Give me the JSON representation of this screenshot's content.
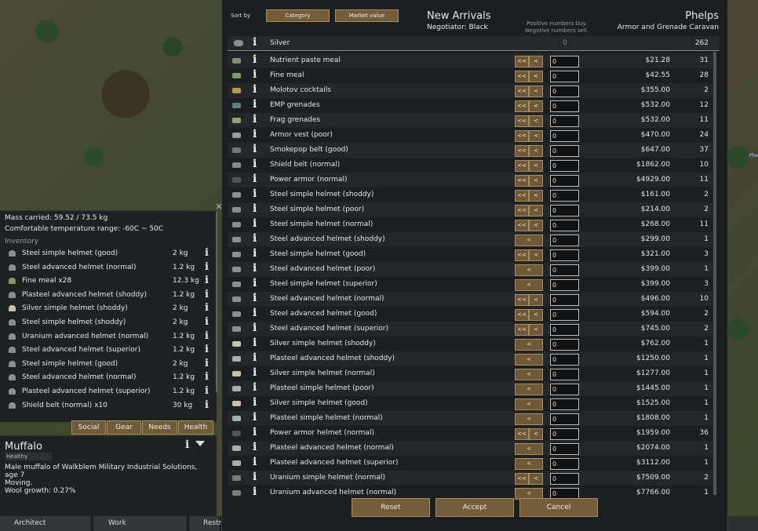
{
  "map": {
    "pawn_label": "Phe"
  },
  "left_panel": {
    "mass": "Mass carried: 59.52 / 73.5 kg",
    "temp": "Comfortable temperature range: -60C ~ 50C",
    "inventory_label": "Inventory",
    "items": [
      {
        "name": "Steel simple helmet (good)",
        "weight": "2 kg"
      },
      {
        "name": "Steel advanced helmet (normal)",
        "weight": "1.2 kg"
      },
      {
        "name": "Fine meal x28",
        "weight": "12.3 kg"
      },
      {
        "name": "Plasteel advanced helmet (shoddy)",
        "weight": "1.2 kg"
      },
      {
        "name": "Silver simple helmet (shoddy)",
        "weight": "2 kg"
      },
      {
        "name": "Steel simple helmet (shoddy)",
        "weight": "2 kg"
      },
      {
        "name": "Uranium advanced helmet (normal)",
        "weight": "1.2 kg"
      },
      {
        "name": "Steel advanced helmet (superior)",
        "weight": "1.2 kg"
      },
      {
        "name": "Steel simple helmet (good)",
        "weight": "2 kg"
      },
      {
        "name": "Steel advanced helmet (normal)",
        "weight": "1.2 kg"
      },
      {
        "name": "Plasteel advanced helmet (superior)",
        "weight": "1.2 kg"
      },
      {
        "name": "Shield belt (normal) x10",
        "weight": "30 kg"
      }
    ],
    "info_glyph": "i",
    "close_glyph": "×"
  },
  "tabs": {
    "social": "Social",
    "gear": "Gear",
    "needs": "Needs",
    "health": "Health"
  },
  "inspect": {
    "name": "Muffalo",
    "health": "Healthy",
    "line1": "Male muffalo of Walkblem Military Industrial Solutions, age 7",
    "line2": "Moving.",
    "line3": "Wool growth: 0.27%"
  },
  "bottom_bar": {
    "architect": "Architect",
    "work": "Work",
    "restrict": "Restr"
  },
  "trade": {
    "sort_by": "Sort by",
    "sort_category": "Category",
    "sort_market": "Market value",
    "title": "New Arrivals",
    "negotiator": "Negotiator: Black",
    "hint_line1": "Positive numbers buy.",
    "hint_line2": "Negative numbers sell.",
    "trader_name": "Phelps",
    "trader_type": "Armor and Grenade Caravan",
    "silver": {
      "name": "Silver",
      "amount": "0",
      "qty": "262"
    },
    "rows": [
      {
        "name": "Nutrient paste meal",
        "buttons": "both",
        "value": "0",
        "price": "$21.28",
        "qty": "31",
        "icon": "#8a8f6a"
      },
      {
        "name": "Fine meal",
        "buttons": "both",
        "value": "0",
        "price": "$42.55",
        "qty": "28",
        "icon": "#7e9a6c"
      },
      {
        "name": "Molotov cocktails",
        "buttons": "both",
        "value": "0",
        "price": "$355.00",
        "qty": "2",
        "icon": "#b59a52"
      },
      {
        "name": "EMP grenades",
        "buttons": "both",
        "value": "0",
        "price": "$532.00",
        "qty": "12",
        "icon": "#5d7f86"
      },
      {
        "name": "Frag grenades",
        "buttons": "both",
        "value": "0",
        "price": "$532.00",
        "qty": "11",
        "icon": "#98a06b"
      },
      {
        "name": "Armor vest (poor)",
        "buttons": "both",
        "value": "0",
        "price": "$470.00",
        "qty": "24",
        "icon": "#9a9a9a"
      },
      {
        "name": "Smokepop belt (good)",
        "buttons": "both",
        "value": "0",
        "price": "$647.00",
        "qty": "37",
        "icon": "#777777"
      },
      {
        "name": "Shield belt (normal)",
        "buttons": "both",
        "value": "0",
        "price": "$1862.00",
        "qty": "10",
        "icon": "#8a8a8a"
      },
      {
        "name": "Power armor (normal)",
        "buttons": "both",
        "value": "0",
        "price": "$4929.00",
        "qty": "11",
        "icon": "#555555"
      },
      {
        "name": "Steel simple helmet (shoddy)",
        "buttons": "both",
        "value": "0",
        "price": "$161.00",
        "qty": "2",
        "icon": "#8e8e8e"
      },
      {
        "name": "Steel simple helmet (poor)",
        "buttons": "both",
        "value": "0",
        "price": "$214.00",
        "qty": "2",
        "icon": "#8e8e8e"
      },
      {
        "name": "Steel simple helmet (normal)",
        "buttons": "both",
        "value": "0",
        "price": "$268.00",
        "qty": "11",
        "icon": "#8e8e8e"
      },
      {
        "name": "Steel advanced helmet (shoddy)",
        "buttons": "single",
        "value": "0",
        "price": "$299.00",
        "qty": "1",
        "icon": "#8e8e8e"
      },
      {
        "name": "Steel simple helmet (good)",
        "buttons": "both",
        "value": "0",
        "price": "$321.00",
        "qty": "3",
        "icon": "#8e8e8e"
      },
      {
        "name": "Steel advanced helmet (poor)",
        "buttons": "single",
        "value": "0",
        "price": "$399.00",
        "qty": "1",
        "icon": "#8e8e8e"
      },
      {
        "name": "Steel simple helmet (superior)",
        "buttons": "single",
        "value": "0",
        "price": "$399.00",
        "qty": "3",
        "icon": "#8e8e8e"
      },
      {
        "name": "Steel advanced helmet (normal)",
        "buttons": "both",
        "value": "0",
        "price": "$496.00",
        "qty": "10",
        "icon": "#8e8e8e"
      },
      {
        "name": "Steel advanced helmet (good)",
        "buttons": "both",
        "value": "0",
        "price": "$594.00",
        "qty": "2",
        "icon": "#8e8e8e"
      },
      {
        "name": "Steel advanced helmet (superior)",
        "buttons": "both",
        "value": "0",
        "price": "$745.00",
        "qty": "2",
        "icon": "#8e8e8e"
      },
      {
        "name": "Silver simple helmet (shoddy)",
        "buttons": "single",
        "value": "0",
        "price": "$762.00",
        "qty": "1",
        "icon": "#c9c2a4"
      },
      {
        "name": "Plasteel advanced helmet (shoddy)",
        "buttons": "single",
        "value": "0",
        "price": "$1250.00",
        "qty": "1",
        "icon": "#a5b0b5"
      },
      {
        "name": "Silver simple helmet (normal)",
        "buttons": "single",
        "value": "0",
        "price": "$1277.00",
        "qty": "1",
        "icon": "#c9c2a4"
      },
      {
        "name": "Plasteel simple helmet (poor)",
        "buttons": "single",
        "value": "0",
        "price": "$1445.00",
        "qty": "1",
        "icon": "#a5b0b5"
      },
      {
        "name": "Silver simple helmet (good)",
        "buttons": "single",
        "value": "0",
        "price": "$1525.00",
        "qty": "1",
        "icon": "#c9c2a4"
      },
      {
        "name": "Plasteel simple helmet (normal)",
        "buttons": "single",
        "value": "0",
        "price": "$1808.00",
        "qty": "1",
        "icon": "#a5b0b5"
      },
      {
        "name": "Power armor helmet (normal)",
        "buttons": "both",
        "value": "0",
        "price": "$1959.00",
        "qty": "36",
        "icon": "#555555"
      },
      {
        "name": "Plasteel advanced helmet (normal)",
        "buttons": "single",
        "value": "0",
        "price": "$2074.00",
        "qty": "1",
        "icon": "#a5b0b5"
      },
      {
        "name": "Plasteel advanced helmet (superior)",
        "buttons": "single",
        "value": "0",
        "price": "$3112.00",
        "qty": "1",
        "icon": "#a5b0b5"
      },
      {
        "name": "Uranium simple helmet (normal)",
        "buttons": "both",
        "value": "0",
        "price": "$7509.00",
        "qty": "2",
        "icon": "#7a7a7a"
      },
      {
        "name": "Uranium advanced helmet (normal)",
        "buttons": "single",
        "value": "0",
        "price": "$7766.00",
        "qty": "1",
        "icon": "#7a7a7a"
      }
    ],
    "btn_double": "<<",
    "btn_single": "<",
    "reset": "Reset",
    "accept": "Accept",
    "cancel": "Cancel"
  }
}
